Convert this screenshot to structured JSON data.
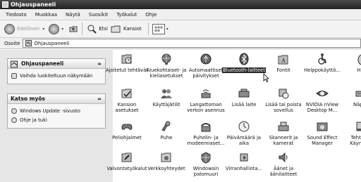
{
  "window": {
    "title": "Ohjauspaneeli"
  },
  "menu": [
    "Tiedosto",
    "Muokkaa",
    "Näytä",
    "Suosikit",
    "Työkalut",
    "Ohje"
  ],
  "toolbar": {
    "back": "Edellinen",
    "search": "Etsi",
    "folders": "Kansiot"
  },
  "address": {
    "label": "Osoite",
    "value": "Ohjauspaneeli"
  },
  "sidebar": {
    "panel1": {
      "title": "Ohjauspaneeli",
      "link": "Vaihda luokiteltuun näkymään"
    },
    "panel2": {
      "title": "Katso myös",
      "links": [
        "Windows Update -sivusto",
        "Ohje ja tuki"
      ]
    }
  },
  "icons": [
    "Ajoitetut tehtävät",
    "Aluekohtaiset- ja kieliasetukset",
    "Automaattiset päivitykset",
    "Bluetooth-laitteet",
    "Fontit",
    "Helppokäyttö...",
    "Hiiri",
    "Kansion asetukset",
    "Käyttäjätilit",
    "Langattoman verkon asennus",
    "Lisää laite",
    "Lisää tai poista sovellus",
    "NVIDIA nView Desktop M...",
    "Näppäi",
    "Peliohjaimet",
    "Puhe",
    "Puhelin- ja modeemiaset...",
    "Päivämäärä ja aika",
    "Skannerit ja kamerat",
    "Sound Effect Manager",
    "Tehtäväp Käynnistä",
    "Valvontatyökalut",
    "Verkkoyhteydet",
    "Windowsin palomuuri",
    "Virranhallinta...",
    "Äänet ja äänilaitteet"
  ]
}
